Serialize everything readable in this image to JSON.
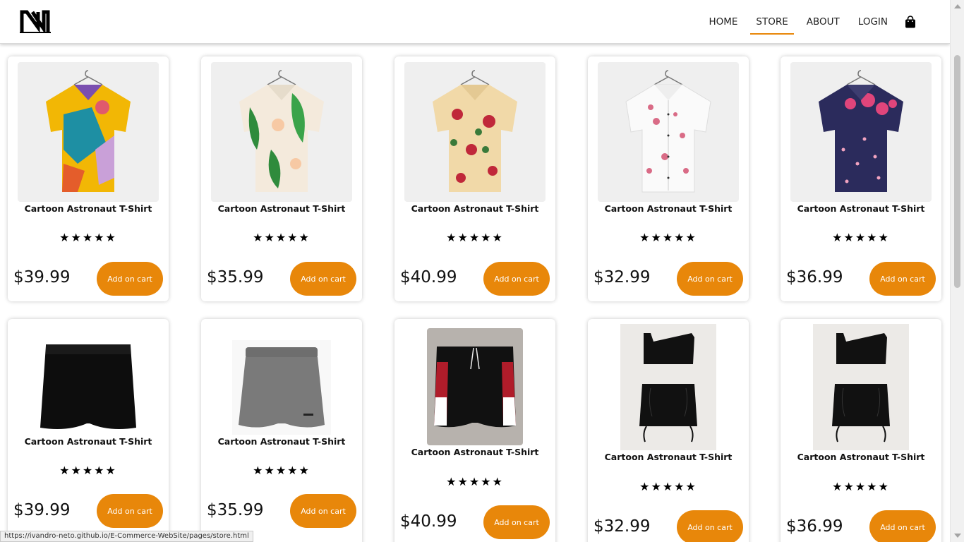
{
  "header": {
    "logo": "NN",
    "nav": [
      "HOME",
      "STORE",
      "ABOUT",
      "LOGIN"
    ],
    "active_nav": "STORE",
    "cart_icon": "shopping-bag-icon"
  },
  "accent_color": "#e8870a",
  "products": [
    {
      "name": "Cartoon Astronaut T-Shirt",
      "rating": "★★★★★",
      "price": "$39.99",
      "button": "Add on cart",
      "image": "shirt-yellow-teal-print"
    },
    {
      "name": "Cartoon Astronaut T-Shirt",
      "rating": "★★★★★",
      "price": "$35.99",
      "button": "Add on cart",
      "image": "shirt-green-leaf-print"
    },
    {
      "name": "Cartoon Astronaut T-Shirt",
      "rating": "★★★★★",
      "price": "$40.99",
      "button": "Add on cart",
      "image": "shirt-beige-red-floral"
    },
    {
      "name": "Cartoon Astronaut T-Shirt",
      "rating": "★★★★★",
      "price": "$32.99",
      "button": "Add on cart",
      "image": "shirt-white-pink-floral"
    },
    {
      "name": "Cartoon Astronaut T-Shirt",
      "rating": "★★★★★",
      "price": "$36.99",
      "button": "Add on cart",
      "image": "shirt-navy-pink-floral"
    },
    {
      "name": "Cartoon Astronaut T-Shirt",
      "rating": "★★★★★",
      "price": "$39.99",
      "button": "Add on cart",
      "image": "shorts-black"
    },
    {
      "name": "Cartoon Astronaut T-Shirt",
      "rating": "★★★★★",
      "price": "$35.99",
      "button": "Add on cart",
      "image": "shorts-grey"
    },
    {
      "name": "Cartoon Astronaut T-Shirt",
      "rating": "★★★★★",
      "price": "$40.99",
      "button": "Add on cart",
      "image": "shorts-black-red-stripe"
    },
    {
      "name": "Cartoon Astronaut T-Shirt",
      "rating": "★★★★★",
      "price": "$32.99",
      "button": "Add on cart",
      "image": "black-top-skirt-set"
    },
    {
      "name": "Cartoon Astronaut T-Shirt",
      "rating": "★★★★★",
      "price": "$36.99",
      "button": "Add on cart",
      "image": "black-top-skirt-set"
    }
  ],
  "status_bar": "https://ivandro-neto.github.io/E-Commerce-WebSite/pages/store.html"
}
